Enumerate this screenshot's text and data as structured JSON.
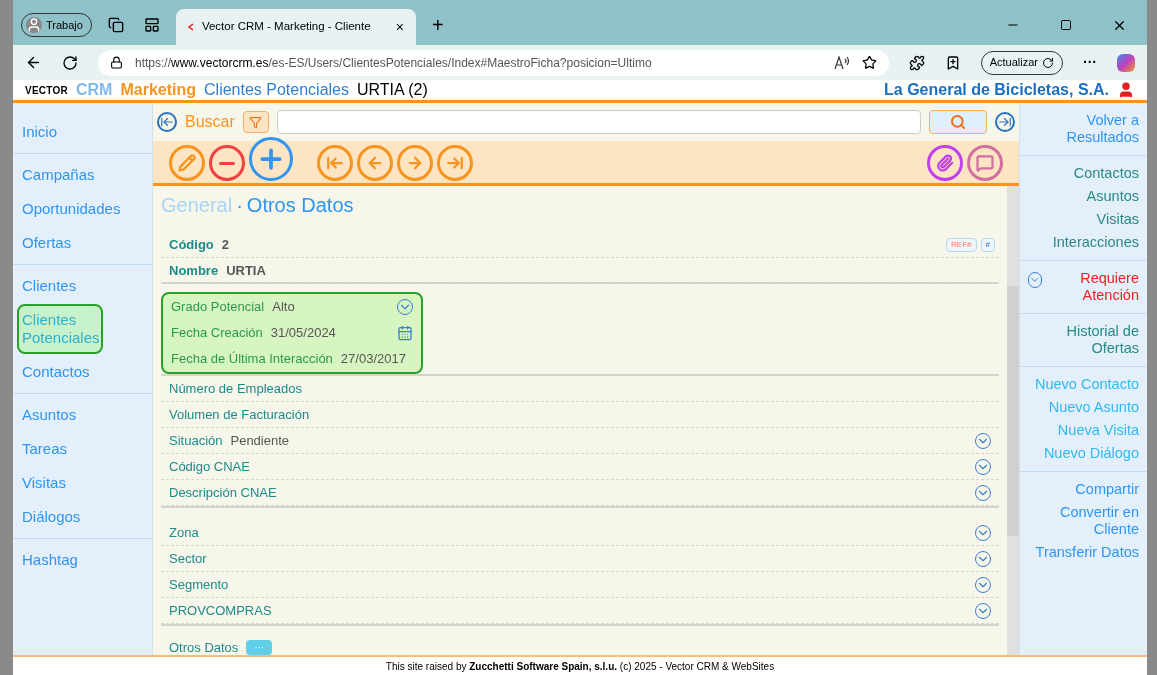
{
  "browser": {
    "profile": "Trabajo",
    "tab_title": "Vector CRM - Marketing - Cliente",
    "tab_close": "×",
    "new_tab": "+",
    "url_prefix": "https://",
    "url_host": "www.vectorcrm.es",
    "url_path": "/es-ES/Users/ClientesPotenciales/Index#MaestroFicha?posicion=Ultimo",
    "update_button": "Actualizar",
    "more": "···"
  },
  "header": {
    "logo": "VECTOR",
    "logo_suffix": "CRM",
    "module": "Marketing",
    "section": "Clientes Potenciales",
    "record": "URTIA (2)",
    "company": "La General de Bicicletas, S.A."
  },
  "sidebar": {
    "groups": [
      [
        {
          "label": "Inicio",
          "selected": false
        }
      ],
      [
        {
          "label": "Campañas",
          "selected": false
        },
        {
          "label": "Oportunidades",
          "selected": false
        },
        {
          "label": "Ofertas",
          "selected": false
        }
      ],
      [
        {
          "label": "Clientes",
          "selected": false
        },
        {
          "label": "Clientes Potenciales",
          "selected": true
        },
        {
          "label": "Contactos",
          "selected": false
        }
      ],
      [
        {
          "label": "Asuntos",
          "selected": false
        },
        {
          "label": "Tareas",
          "selected": false
        },
        {
          "label": "Visitas",
          "selected": false
        },
        {
          "label": "Diálogos",
          "selected": false
        }
      ],
      [
        {
          "label": "Hashtag",
          "selected": false
        }
      ]
    ]
  },
  "search": {
    "label": "Buscar"
  },
  "toolbar": {
    "left": [
      {
        "kind": "edit"
      },
      {
        "kind": "delete"
      },
      {
        "kind": "add"
      }
    ],
    "nav": [
      {
        "kind": "first"
      },
      {
        "kind": "prev"
      },
      {
        "kind": "next"
      },
      {
        "kind": "last"
      }
    ],
    "right": [
      {
        "kind": "attach"
      },
      {
        "kind": "comment"
      }
    ]
  },
  "breadcrumb": {
    "separator": "·",
    "items": [
      {
        "label": "General",
        "selected": false
      },
      {
        "label": "Otros Datos",
        "selected": true
      }
    ]
  },
  "record": {
    "tags": [
      "REF#",
      "#"
    ],
    "groups": [
      {
        "kind": "key",
        "highlighted": false,
        "fields": [
          {
            "label": "Código",
            "value": "2",
            "kind": "plain"
          },
          {
            "label": "Nombre",
            "value": "URTIA",
            "kind": "plain"
          }
        ]
      },
      {
        "kind": "detail",
        "highlighted": true,
        "fields": [
          {
            "label": "Grado Potencial",
            "value": "Alto",
            "kind": "dropdown"
          },
          {
            "label": "Fecha Creación",
            "value": "31/05/2024",
            "kind": "calendar"
          },
          {
            "label": "Fecha de Última Interacción",
            "value": "27/03/2017",
            "kind": "plain"
          }
        ]
      },
      {
        "kind": "detail",
        "highlighted": false,
        "fields": [
          {
            "label": "Número de Empleados",
            "kind": "plain"
          },
          {
            "label": "Volumen de Facturación",
            "kind": "plain"
          },
          {
            "label": "Situación",
            "value": "Pendiente",
            "kind": "dropdown"
          },
          {
            "label": "Código CNAE",
            "kind": "dropdown"
          },
          {
            "label": "Descripción CNAE",
            "kind": "dropdown"
          }
        ]
      },
      {
        "kind": "detail",
        "highlighted": false,
        "fields": [
          {
            "label": "Zona",
            "kind": "dropdown"
          },
          {
            "label": "Sector",
            "kind": "dropdown"
          },
          {
            "label": "Segmento",
            "kind": "dropdown"
          },
          {
            "label": "PROVCOMPRAS",
            "kind": "dropdown"
          }
        ]
      }
    ],
    "section": {
      "label": "Otros Datos",
      "badge": "···"
    }
  },
  "actions": {
    "groups": [
      [
        {
          "label": "Volver a Resultados",
          "kind": "nav"
        }
      ],
      [
        {
          "label": "Contactos",
          "kind": "related"
        },
        {
          "label": "Asuntos",
          "kind": "related"
        },
        {
          "label": "Visitas",
          "kind": "related"
        },
        {
          "label": "Interacciones",
          "kind": "related"
        }
      ],
      [
        {
          "label": "Requiere Atención",
          "kind": "alert"
        }
      ],
      [
        {
          "label": "Historial de Ofertas",
          "kind": "related"
        }
      ],
      [
        {
          "label": "Nuevo Contacto",
          "kind": "new"
        },
        {
          "label": "Nuevo Asunto",
          "kind": "new"
        },
        {
          "label": "Nueva Visita",
          "kind": "new"
        },
        {
          "label": "Nuevo Diálogo",
          "kind": "new"
        }
      ],
      [
        {
          "label": "Compartir",
          "kind": "nav"
        },
        {
          "label": "Convertir en Cliente",
          "kind": "nav"
        },
        {
          "label": "Transferir Datos",
          "kind": "nav"
        }
      ]
    ]
  },
  "footer": "This site raised by **Zucchetti Software Spain, s.l.u.** (c) 2025 - Vector CRM & WebSites"
}
